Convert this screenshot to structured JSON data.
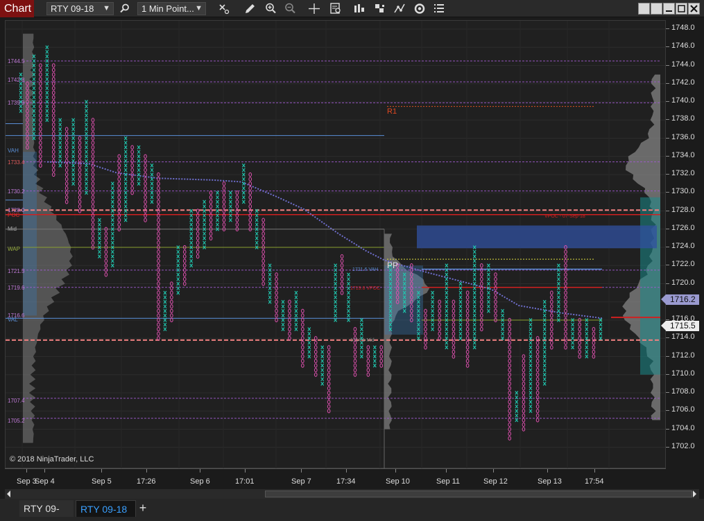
{
  "window": {
    "title": "Chart",
    "instrument": "RTY 09-18",
    "interval": "1 Min Point..."
  },
  "toolbar": {
    "icons": [
      "search-icon",
      "eraser-icon",
      "pencil-icon",
      "zoom-in-icon",
      "zoom-out-icon",
      "crosshair-icon",
      "data-box-icon",
      "bar-type-icon",
      "indicators-icon",
      "strategies-icon",
      "refresh-icon",
      "properties-icon"
    ],
    "window_buttons": [
      "restore-icon",
      "link-icon",
      "minimize-icon",
      "maximize-icon",
      "close-icon"
    ]
  },
  "chart": {
    "copyright": "© 2018 NinjaTrader, LLC",
    "last_price": "1715.5",
    "poc_price": "1716.2",
    "price_axis": [
      "1748.0",
      "1746.0",
      "1744.0",
      "1742.0",
      "1740.0",
      "1738.0",
      "1736.0",
      "1734.0",
      "1732.0",
      "1730.0",
      "1728.0",
      "1726.0",
      "1724.0",
      "1722.0",
      "1720.0",
      "1718.0",
      "1716.0",
      "1714.0",
      "1712.0",
      "1710.0",
      "1708.0",
      "1706.0",
      "1704.0",
      "1702.0"
    ],
    "time_axis": [
      "Sep 3",
      "Sep 4",
      "Sep 5",
      "17:26",
      "Sep 6",
      "17:01",
      "Sep 7",
      "17:34",
      "Sep 10",
      "Sep 11",
      "Sep 12",
      "Sep 13",
      "17:54"
    ],
    "left_levels": [
      {
        "label": "1744.5",
        "color": "#c07ad8"
      },
      {
        "label": "1742.8",
        "color": "#c07ad8"
      },
      {
        "label": "1739.9",
        "color": "#c07ad8"
      },
      {
        "label": "VAH",
        "color": "#5a8fd8"
      },
      {
        "label": "1733.4",
        "color": "#e05a5a"
      },
      {
        "label": "1730.2",
        "color": "#c07ad8"
      },
      {
        "label": "1728.0",
        "color": "#c07ad8"
      },
      {
        "label": "POC",
        "color": "#e02a2a"
      },
      {
        "label": "Mid",
        "color": "#aaaaaa"
      },
      {
        "label": "WAP",
        "color": "#9ab040"
      },
      {
        "label": "1721.5",
        "color": "#c07ad8"
      },
      {
        "label": "1719.6",
        "color": "#c07ad8"
      },
      {
        "label": "1716.6",
        "color": "#c07ad8"
      },
      {
        "label": "VAL",
        "color": "#5a8fd8"
      },
      {
        "label": "1707.4",
        "color": "#c07ad8"
      },
      {
        "label": "1705.2",
        "color": "#c07ad8"
      }
    ],
    "annotations": {
      "r1": "R1",
      "pp": "PP",
      "vpoc": "VPOC - 07-Sep-18",
      "vah2": "1721.6 VAH",
      "vpoc2": "1719.6 VPOC",
      "mid2": "1714.1 Mid"
    }
  },
  "tabs": [
    "RTY 09-18",
    "RTY 09-18"
  ],
  "add_tab_label": "+"
}
